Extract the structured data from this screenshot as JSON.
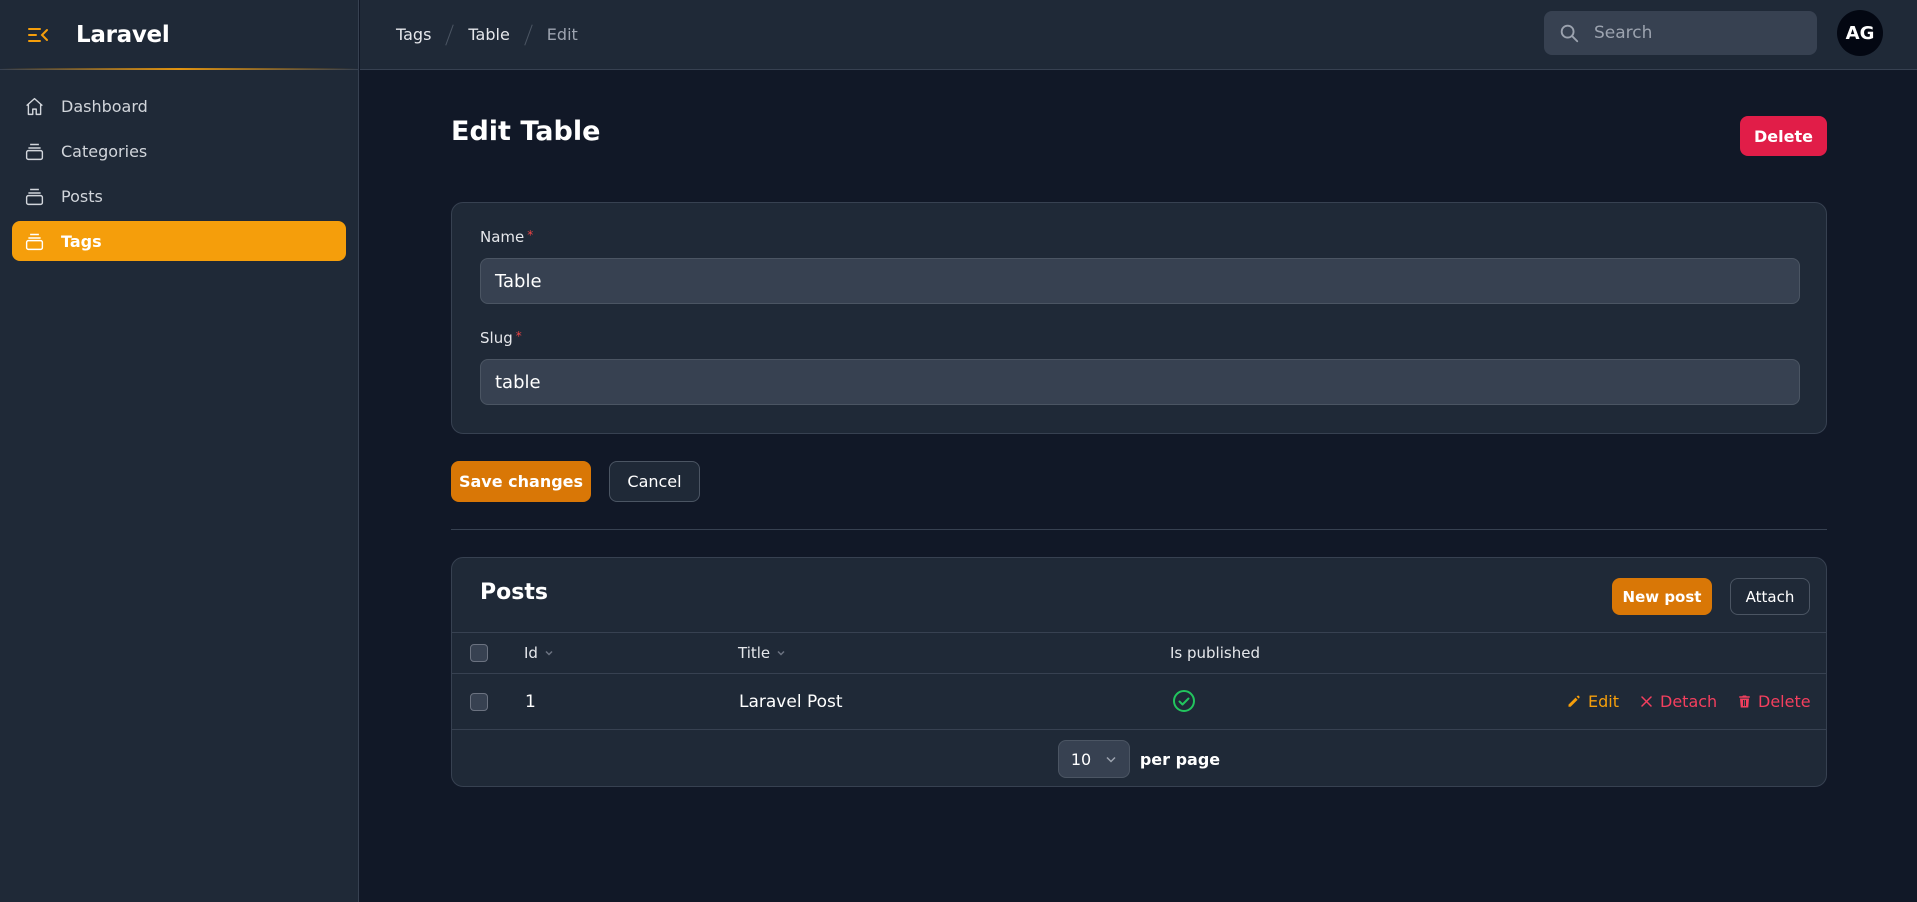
{
  "app": {
    "brand": "Laravel"
  },
  "colors": {
    "accent": "#f59e0b",
    "primary_button": "#d97706",
    "danger": "#e11d48",
    "success": "#22c55e"
  },
  "sidebar": {
    "items": [
      {
        "label": "Dashboard",
        "icon": "home-icon",
        "active": false
      },
      {
        "label": "Categories",
        "icon": "collection-icon",
        "active": false
      },
      {
        "label": "Posts",
        "icon": "collection-icon",
        "active": false
      },
      {
        "label": "Tags",
        "icon": "collection-icon",
        "active": true
      }
    ]
  },
  "topbar": {
    "breadcrumbs": [
      "Tags",
      "Table",
      "Edit"
    ],
    "search_placeholder": "Search",
    "avatar_initials": "AG"
  },
  "page": {
    "title": "Edit Table",
    "delete_label": "Delete"
  },
  "form": {
    "fields": [
      {
        "label": "Name",
        "required_mark": "*",
        "value": "Table"
      },
      {
        "label": "Slug",
        "required_mark": "*",
        "value": "table"
      }
    ],
    "save_label": "Save changes",
    "cancel_label": "Cancel"
  },
  "posts_table": {
    "title": "Posts",
    "new_label": "New post",
    "attach_label": "Attach",
    "columns": [
      "Id",
      "Title",
      "Is published"
    ],
    "rows": [
      {
        "id": "1",
        "title": "Laravel Post",
        "is_published": true
      }
    ],
    "row_actions": [
      "Edit",
      "Detach",
      "Delete"
    ],
    "per_page_value": "10",
    "per_page_label": "per page"
  }
}
